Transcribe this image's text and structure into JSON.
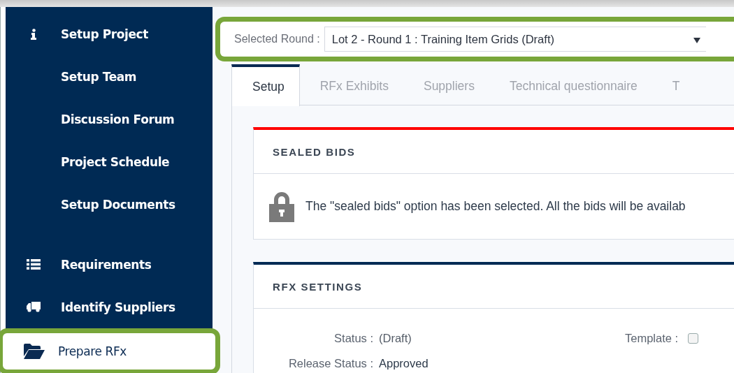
{
  "sidebar": {
    "sections": [
      {
        "items": [
          {
            "label": "Setup Project",
            "kind": "info",
            "selected": false,
            "highlighted": false
          },
          {
            "label": "Setup Team",
            "kind": "plain",
            "selected": false,
            "highlighted": false
          },
          {
            "label": "Discussion Forum",
            "kind": "plain",
            "selected": false,
            "highlighted": false
          },
          {
            "label": "Project Schedule",
            "kind": "plain",
            "selected": false,
            "highlighted": false
          },
          {
            "label": "Setup Documents",
            "kind": "plain",
            "selected": false,
            "highlighted": false
          }
        ]
      },
      {
        "items": [
          {
            "label": "Requirements",
            "kind": "list",
            "selected": false,
            "highlighted": false
          },
          {
            "label": "Identify Suppliers",
            "kind": "truck",
            "selected": false,
            "highlighted": false
          },
          {
            "label": "Prepare RFx",
            "kind": "folder",
            "selected": true,
            "highlighted": true
          }
        ]
      }
    ]
  },
  "round_selector": {
    "label": "Selected Round :",
    "value": "Lot 2 - Round 1 : Training Item Grids (Draft)",
    "highlighted": true
  },
  "tabs": [
    {
      "label": "Setup",
      "selected": true
    },
    {
      "label": "RFx Exhibits",
      "selected": false
    },
    {
      "label": "Suppliers",
      "selected": false
    },
    {
      "label": "Technical questionnaire",
      "selected": false
    },
    {
      "label": "T",
      "selected": false
    }
  ],
  "cards": [
    {
      "title": "SEALED BIDS",
      "color": "#ff0000",
      "kind": "notice",
      "message": "The \"sealed bids\" option has been selected. All the bids will be availab"
    },
    {
      "title": "RFX SETTINGS",
      "color": "#002a54",
      "kind": "settings",
      "fields": [
        {
          "label": "Status :",
          "value": "(Draft)",
          "side_label": "Template :",
          "checked": false
        },
        {
          "label": "Release Status :",
          "value": "Approved"
        }
      ]
    }
  ]
}
